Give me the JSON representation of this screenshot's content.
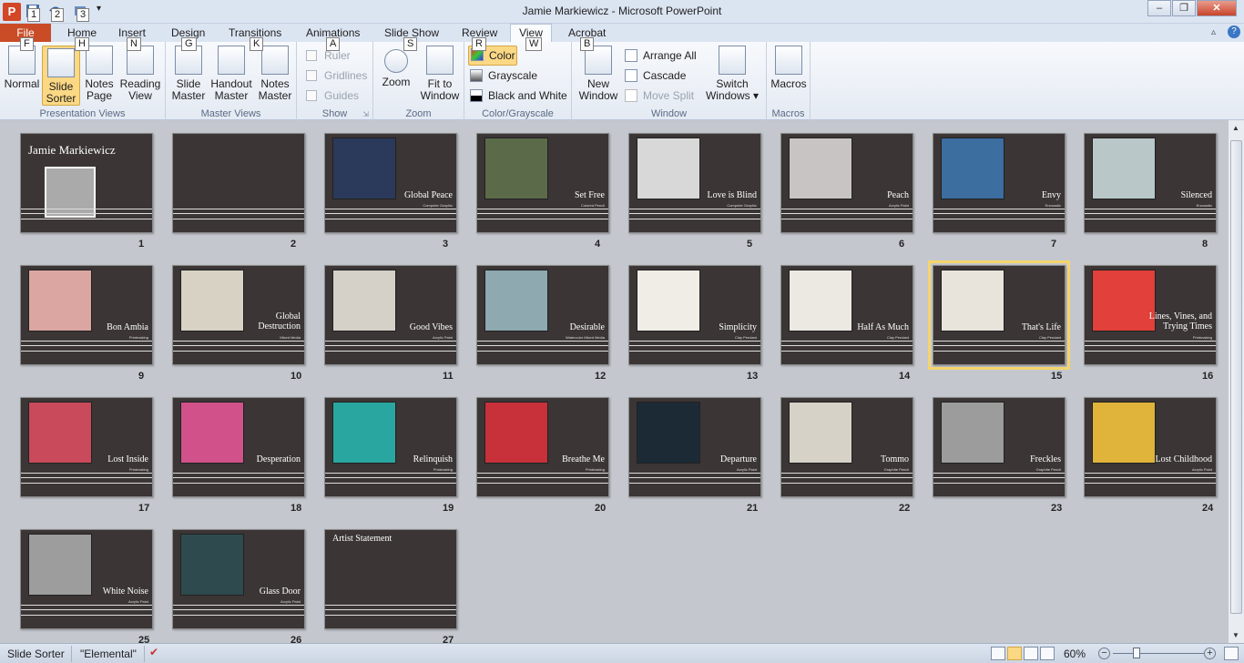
{
  "window": {
    "title": "Jamie Markiewicz  -  Microsoft PowerPoint",
    "minimize": "–",
    "restore": "❐",
    "close": "✕"
  },
  "keytips": {
    "qat1": "1",
    "qat2": "2",
    "qat3": "3",
    "file": "F",
    "home": "H",
    "insert": "N",
    "design": "G",
    "transitions": "K",
    "animations": "A",
    "slideshow": "S",
    "review": "R",
    "view": "W",
    "acrobat": "B"
  },
  "tabs": [
    "File",
    "Home",
    "Insert",
    "Design",
    "Transitions",
    "Animations",
    "Slide Show",
    "Review",
    "View",
    "Acrobat"
  ],
  "ribbon": {
    "presentation_views": {
      "label": "Presentation Views",
      "buttons": [
        "Normal",
        "Slide\nSorter",
        "Notes\nPage",
        "Reading\nView"
      ]
    },
    "master_views": {
      "label": "Master Views",
      "buttons": [
        "Slide\nMaster",
        "Handout\nMaster",
        "Notes\nMaster"
      ]
    },
    "show": {
      "label": "Show",
      "items": [
        "Ruler",
        "Gridlines",
        "Guides"
      ]
    },
    "zoom": {
      "label": "Zoom",
      "buttons": [
        "Zoom",
        "Fit to\nWindow"
      ]
    },
    "color": {
      "label": "Color/Grayscale",
      "items": [
        "Color",
        "Grayscale",
        "Black and White"
      ]
    },
    "window": {
      "label": "Window",
      "new_window": "New\nWindow",
      "items": [
        "Arrange All",
        "Cascade",
        "Move Split"
      ],
      "switch": "Switch\nWindows ▾"
    },
    "macros": {
      "label": "Macros",
      "buttons": [
        "Macros"
      ]
    }
  },
  "slides": [
    {
      "n": "1",
      "title": "Jamie Markiewicz",
      "sub": ""
    },
    {
      "n": "2",
      "title": "",
      "sub": ""
    },
    {
      "n": "3",
      "title": "Global Peace",
      "sub": "Computer Graphic"
    },
    {
      "n": "4",
      "title": "Set Free",
      "sub": "Colored Pencil"
    },
    {
      "n": "5",
      "title": "Love is Blind",
      "sub": "Computer Graphic"
    },
    {
      "n": "6",
      "title": "Peach",
      "sub": "Acrylic Paint"
    },
    {
      "n": "7",
      "title": "Envy",
      "sub": "Encaustic"
    },
    {
      "n": "8",
      "title": "Silenced",
      "sub": "Encaustic"
    },
    {
      "n": "9",
      "title": "Bon Ambia",
      "sub": "Printmaking"
    },
    {
      "n": "10",
      "title": "Global\nDestruction",
      "sub": "Mixed Media"
    },
    {
      "n": "11",
      "title": "Good Vibes",
      "sub": "Acrylic Paint"
    },
    {
      "n": "12",
      "title": "Desirable",
      "sub": "Watercolor Mixed Media"
    },
    {
      "n": "13",
      "title": "Simplicity",
      "sub": "Clay Pendant"
    },
    {
      "n": "14",
      "title": "Half As Much",
      "sub": "Clay Pendant"
    },
    {
      "n": "15",
      "title": "That's Life",
      "sub": "Clay Pendant"
    },
    {
      "n": "16",
      "title": "Lines, Vines, and\nTrying Times",
      "sub": "Printmaking"
    },
    {
      "n": "17",
      "title": "Lost Inside",
      "sub": "Printmaking"
    },
    {
      "n": "18",
      "title": "Desperation",
      "sub": ""
    },
    {
      "n": "19",
      "title": "Relinquish",
      "sub": "Printmaking"
    },
    {
      "n": "20",
      "title": "Breathe Me",
      "sub": "Printmaking"
    },
    {
      "n": "21",
      "title": "Departure",
      "sub": "Acrylic Paint"
    },
    {
      "n": "22",
      "title": "Tommo",
      "sub": "Graphite Pencil"
    },
    {
      "n": "23",
      "title": "Freckles",
      "sub": "Graphite Pencil"
    },
    {
      "n": "24",
      "title": "Lost Childhood",
      "sub": "Acrylic Paint"
    },
    {
      "n": "25",
      "title": "White Noise",
      "sub": "Acrylic Paint"
    },
    {
      "n": "26",
      "title": "Glass Door",
      "sub": "Acrylic Paint"
    },
    {
      "n": "27",
      "title": "Artist Statement",
      "sub": ""
    }
  ],
  "selected_slide": "15",
  "status": {
    "view": "Slide Sorter",
    "theme": "\"Elemental\"",
    "zoom": "60%"
  },
  "colors": {
    "accent_file": "#c94c27",
    "slide_bg": "#3b3535",
    "selection": "#f5d56b"
  }
}
